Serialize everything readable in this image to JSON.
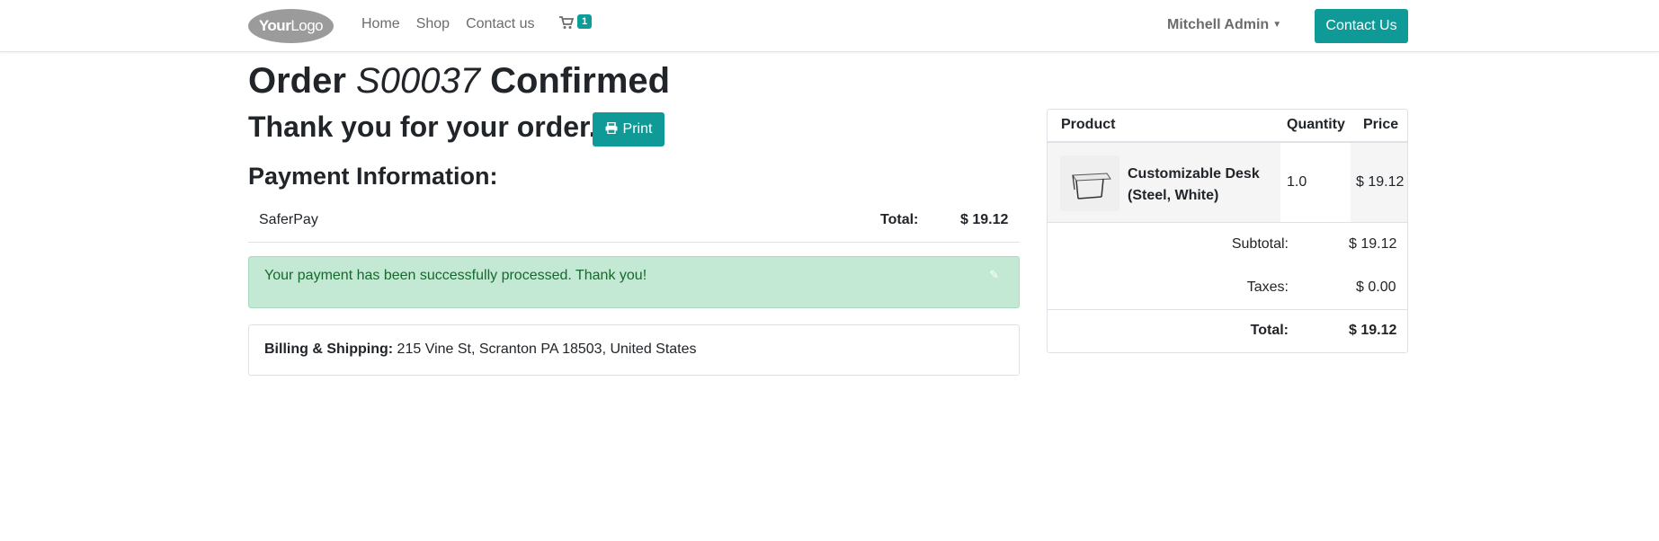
{
  "header": {
    "logo_your": "Your",
    "logo_logo": "Logo",
    "nav": [
      "Home",
      "Shop",
      "Contact us"
    ],
    "cart_count": "1",
    "user": "Mitchell Admin",
    "contact_button": "Contact Us"
  },
  "order": {
    "title_prefix": "Order ",
    "order_id": "S00037",
    "title_suffix": " Confirmed",
    "thanks": "Thank you for your order.",
    "print_label": "Print"
  },
  "payment": {
    "heading": "Payment Information:",
    "method": "SaferPay",
    "total_label": "Total:",
    "total_value": "$ 19.12",
    "success_message": "Your payment has been successfully processed. Thank you!"
  },
  "billing": {
    "label": "Billing & Shipping:",
    "address": "215 Vine St, Scranton PA 18503, United States"
  },
  "cart_table": {
    "columns": [
      "Product",
      "Quantity",
      "Price"
    ],
    "items": [
      {
        "name_line1": "Customizable Desk",
        "name_line2": "(Steel, White)",
        "quantity": "1.0",
        "price": "$ 19.12"
      }
    ],
    "subtotal_label": "Subtotal:",
    "subtotal_value": "$ 19.12",
    "taxes_label": "Taxes:",
    "taxes_value": "$ 0.00",
    "total_label": "Total:",
    "total_value": "$ 19.12"
  },
  "colors": {
    "primary": "#0f9a98",
    "corner_badge": "#7c4a7d",
    "alert_bg": "#c3e8d3",
    "alert_text": "#16692d"
  },
  "icons": {
    "cart": "shopping-cart-icon",
    "print": "printer-icon",
    "edit": "pencil-icon",
    "caret": "caret-down-icon"
  }
}
